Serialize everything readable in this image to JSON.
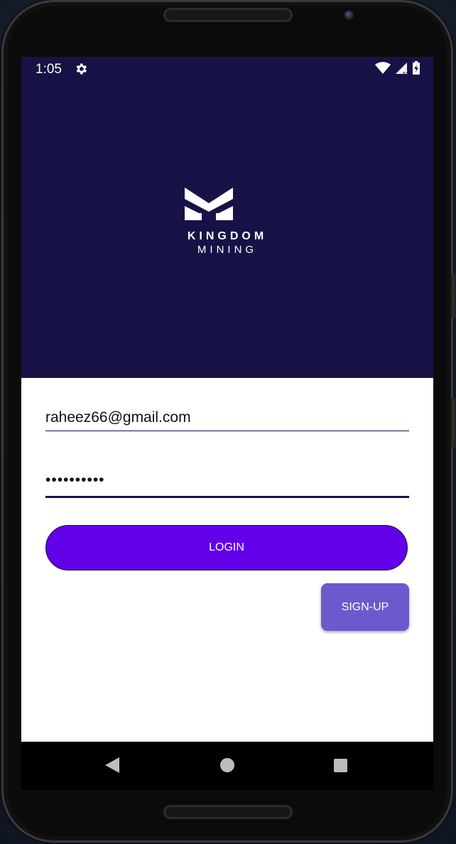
{
  "status_bar": {
    "time": "1:05",
    "icons": [
      "gear-icon",
      "wifi-icon",
      "signal-icon",
      "battery-charging-icon"
    ]
  },
  "brand": {
    "line1": "KINGDOM",
    "line2": "MINING",
    "logo": "kingdom-mining-logo"
  },
  "login_form": {
    "email_value": "raheez66@gmail.com",
    "password_value": "••••••••••",
    "login_label": "LOGIN",
    "signup_label": "SIGN-UP"
  },
  "nav_bar": {
    "icons": [
      "back-icon",
      "home-icon",
      "recents-icon"
    ]
  },
  "colors": {
    "hero_bg": "#171246",
    "login_button": "#6200ea",
    "signup_button": "#6a5acd",
    "field_underline": "#171246"
  }
}
